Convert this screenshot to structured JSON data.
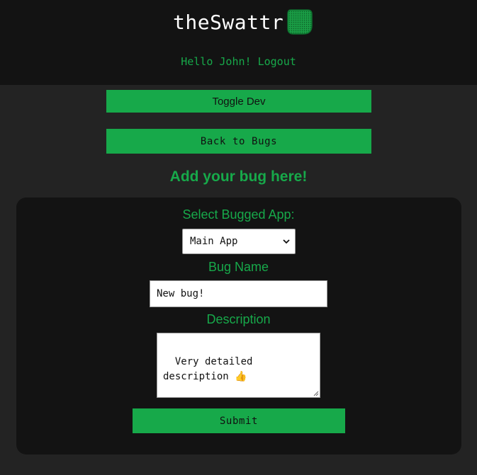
{
  "header": {
    "brand": "theSwattr",
    "logo_icon": "fly-swatter-icon",
    "greeting": "Hello John!",
    "logout_label": "Logout"
  },
  "buttons": {
    "toggle_dev": "Toggle Dev",
    "back_to_bugs": "Back to Bugs",
    "submit": "Submit"
  },
  "page": {
    "title": "Add your bug here!"
  },
  "form": {
    "app_label": "Select Bugged App:",
    "app_selected": "Main App",
    "bug_name_label": "Bug Name",
    "bug_name_value": "New bug!",
    "description_label": "Description",
    "description_value": "Very detailed\ndescription 👍"
  },
  "colors": {
    "accent": "#17a94a",
    "header_bg": "#131313",
    "page_bg": "#232323",
    "card_bg": "#131313"
  }
}
